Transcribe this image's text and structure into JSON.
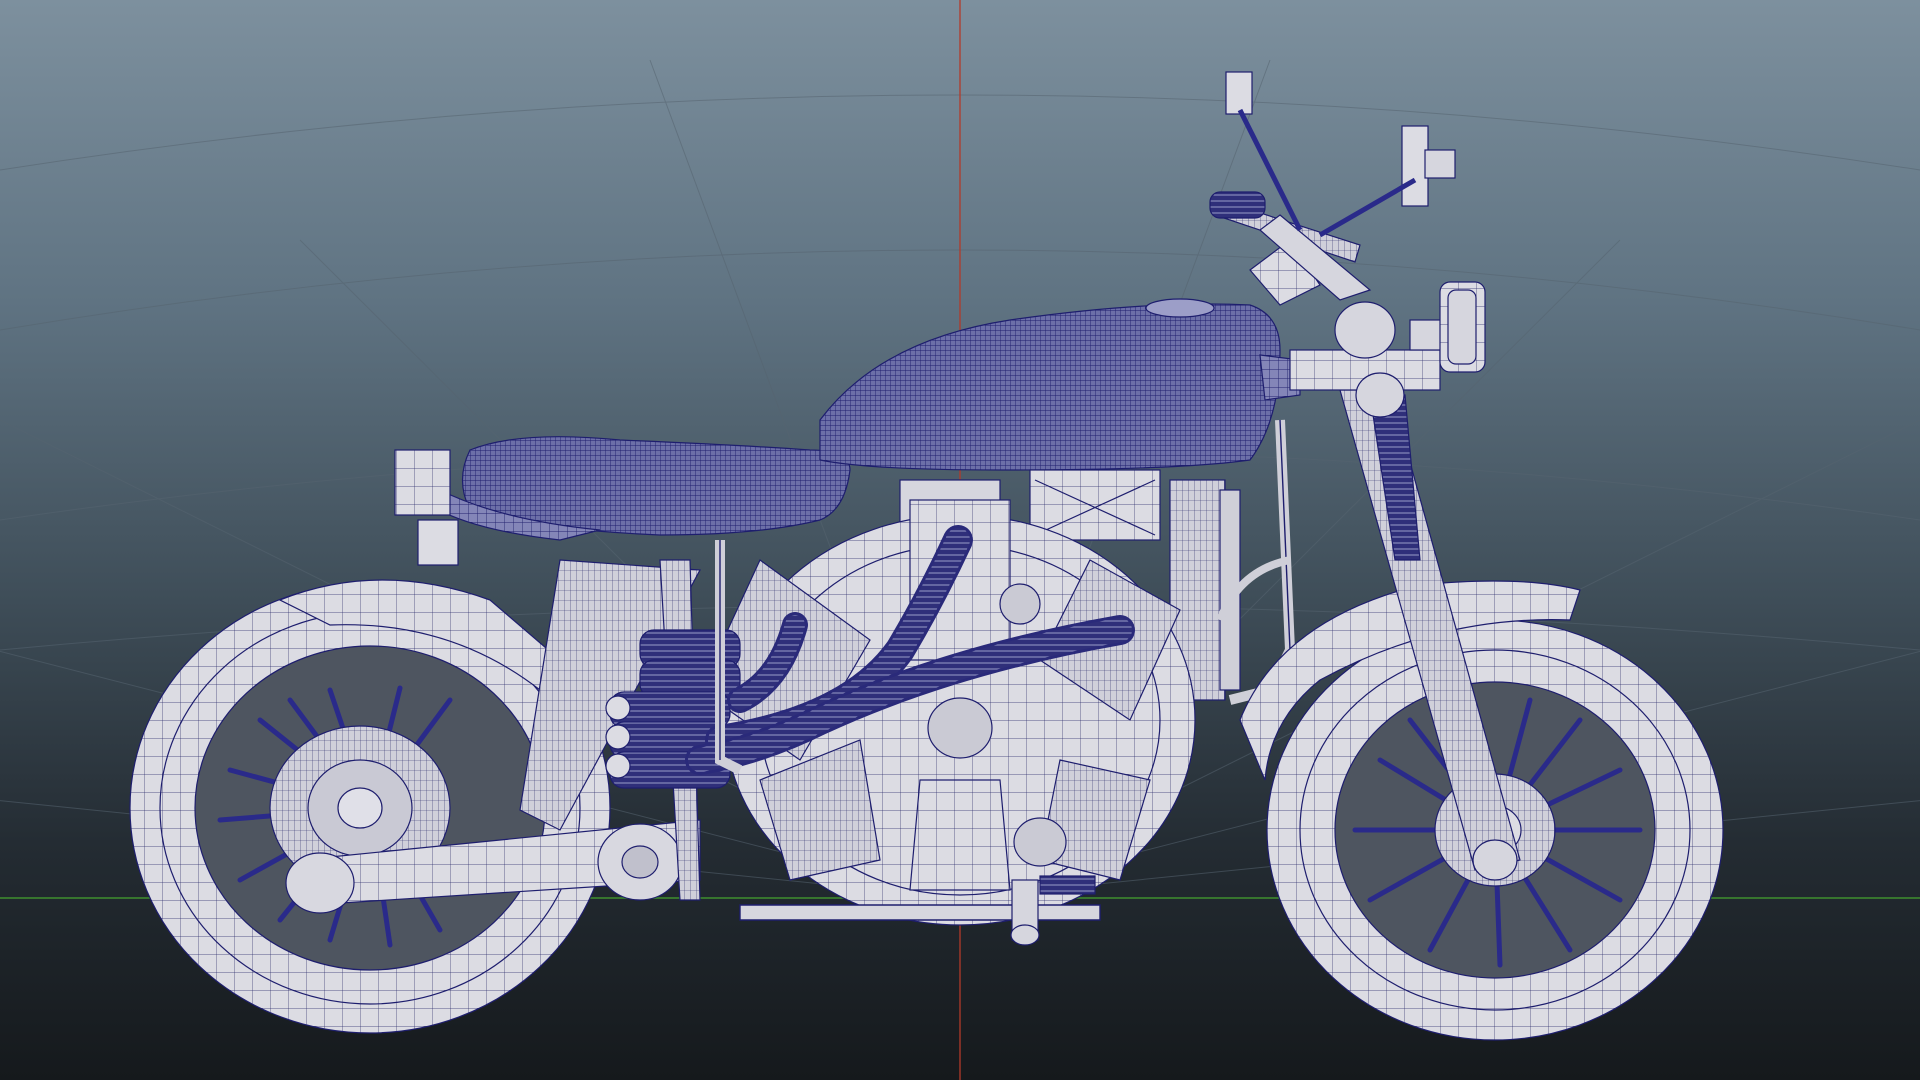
{
  "viewport": {
    "mode": "perspective",
    "display": "wireframe-on-shaded",
    "object": "motorcycle-model",
    "colors": {
      "background_top": "#7d909e",
      "background_bottom": "#15191c",
      "grid": "#5a6873",
      "axis_x": "#3f8f2f",
      "axis_z": "#b23a2a",
      "shaded": "#d9d9df",
      "wire": "#1e1e6e",
      "dense_wire": "#2a2a80"
    }
  }
}
